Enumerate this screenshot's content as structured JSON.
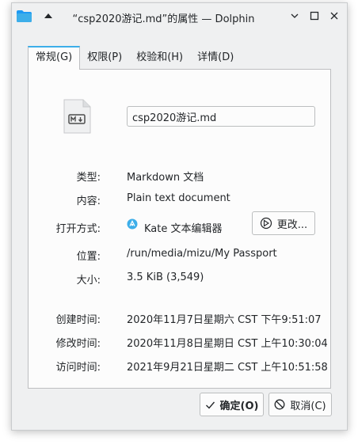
{
  "window": {
    "title": "“csp2020游记.md”的属性 — Dolphin",
    "accent_color": "#3daee9"
  },
  "tabs": [
    {
      "label": "常规(G)",
      "active": true
    },
    {
      "label": "权限(P)",
      "active": false
    },
    {
      "label": "校验和(H)",
      "active": false
    },
    {
      "label": "详情(D)",
      "active": false
    }
  ],
  "general": {
    "file_icon": "markdown-file-icon",
    "filename": "csp2020游记.md",
    "type_label": "类型:",
    "type_value": "Markdown 文档",
    "content_label": "内容:",
    "content_value": "Plain text document",
    "open_with_label": "打开方式:",
    "open_with_value": "Kate 文本编辑器",
    "change_button": "更改...",
    "location_label": "位置:",
    "location_value": "/run/media/mizu/My Passport",
    "size_label": "大小:",
    "size_value": "3.5 KiB (3,549)",
    "created_label": "创建时间:",
    "created_value": "2020年11月7日星期六 CST 下午9:51:07",
    "modified_label": "修改时间:",
    "modified_value": "2020年11月8日星期日 CST 上午10:30:04",
    "accessed_label": "访问时间:",
    "accessed_value": "2021年9月21日星期二 CST 上午10:51:58"
  },
  "buttons": {
    "ok": "确定(O)",
    "cancel": "取消(C)"
  }
}
